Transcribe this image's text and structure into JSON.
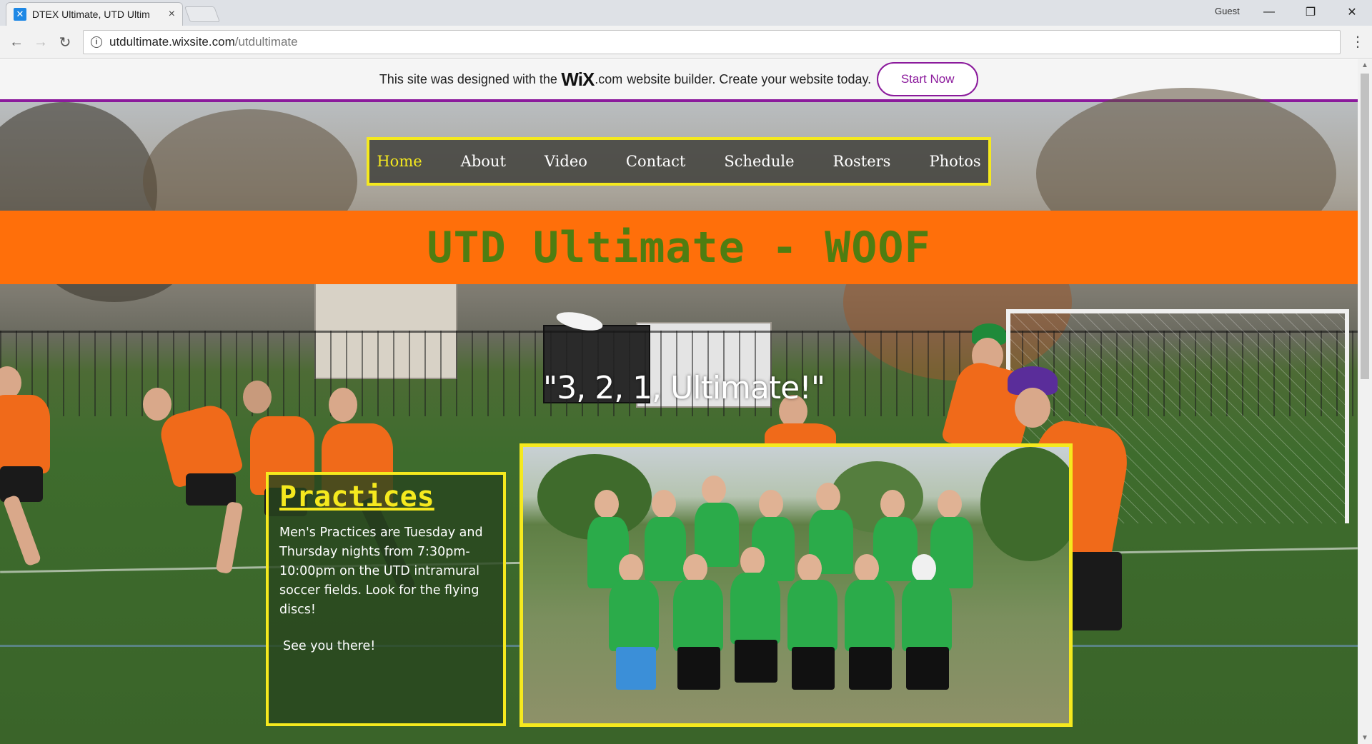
{
  "browser": {
    "tab_title": "DTEX Ultimate, UTD Ultim",
    "tab_close": "×",
    "profile_label": "Guest",
    "url_host": "utdultimate.wixsite.com",
    "url_path": "/utdultimate",
    "win_minimize": "—",
    "win_maximize": "❐",
    "win_close": "✕",
    "back": "←",
    "forward": "→",
    "reload": "↻",
    "menu": "⋮"
  },
  "wix_banner": {
    "text_before": "This site was designed with the",
    "logo": "WiX",
    "logo_suffix": ".com",
    "text_after": "website builder. Create your website today.",
    "cta_label": "Start Now",
    "accent_color": "#8b1a9c"
  },
  "site": {
    "nav": [
      {
        "label": "Home",
        "active": true
      },
      {
        "label": "About"
      },
      {
        "label": "Video"
      },
      {
        "label": "Contact"
      },
      {
        "label": "Schedule"
      },
      {
        "label": "Rosters"
      },
      {
        "label": "Photos"
      }
    ],
    "title": "UTD Ultimate - WOOF",
    "tagline": "\"3, 2, 1, Ultimate!\"",
    "practices": {
      "heading": "Practices",
      "body": "Men's Practices are Tuesday and Thursday nights from 7:30pm-10:00pm on the UTD intramural soccer fields. Look for the flying discs!",
      "closing": "See you there!"
    },
    "colors": {
      "title_band": "#ff6f0a",
      "title_text": "#4f7d11",
      "frame_yellow": "#f5e91e"
    }
  }
}
